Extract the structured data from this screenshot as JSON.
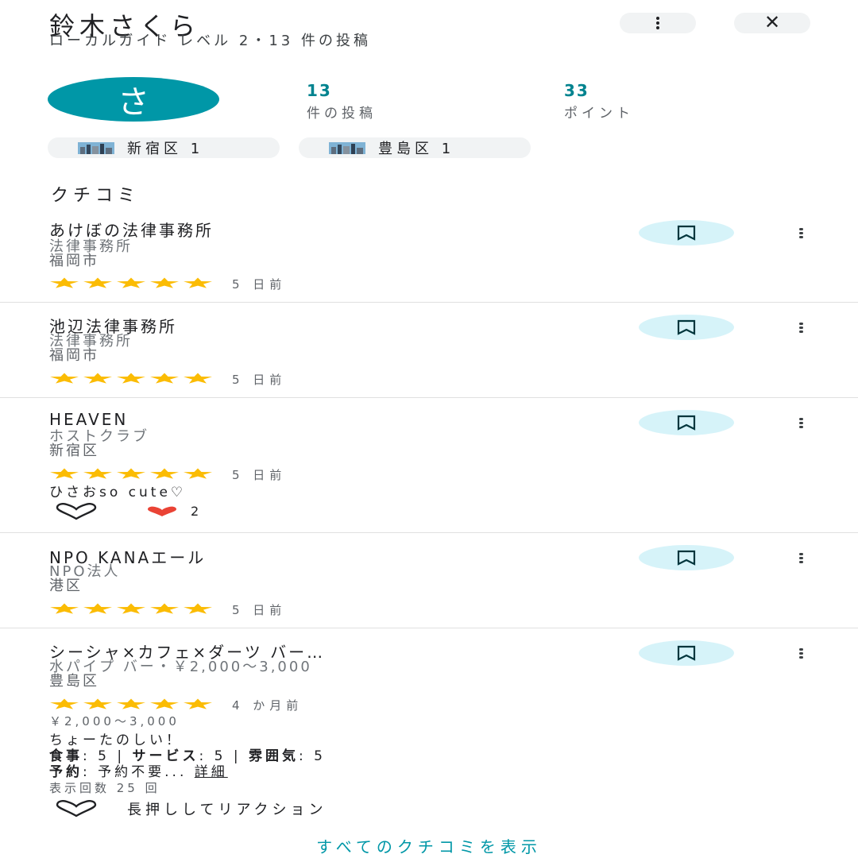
{
  "profile": {
    "name": "鈴木さくら",
    "subtitle": "ローカルガイド レベル 2・13 件の投稿",
    "avatar_letter": "さ",
    "avatar_color": "#0097a7",
    "posts_count": "13",
    "posts_label": "件の投稿",
    "points_count": "33",
    "points_label": "ポイント"
  },
  "area_chips": [
    {
      "label": "新宿区 1",
      "icon": "city-icon"
    },
    {
      "label": "豊島区 1",
      "icon": "city-icon"
    }
  ],
  "section_title": "クチコミ",
  "reviews": [
    {
      "name": "あけぼの法律事務所",
      "category": "法律事務所",
      "city": "福岡市",
      "rating": 5,
      "date": "5 日前"
    },
    {
      "name": "池辺法律事務所",
      "category": "法律事務所",
      "city": "福岡市",
      "rating": 5,
      "date": "5 日前"
    },
    {
      "name": "HEAVEN",
      "category": "ホストクラブ",
      "city": "新宿区",
      "rating": 5,
      "date": "5 日前",
      "text": "ひさおso cute♡",
      "reaction_count": "2"
    },
    {
      "name": "NPO KANAエール",
      "category": "NPO法人",
      "city": "港区",
      "rating": 5,
      "date": "5 日前"
    },
    {
      "name": "シーシャ×カフェ×ダーツ バー…",
      "category": "水パイプ バー・￥2,000〜3,000",
      "city": "豊島区",
      "rating": 5,
      "date": "4 か月前",
      "price": "￥2,000〜3,000",
      "text": "ちょーたのしい！",
      "food_label": "食事",
      "food_value": ": 5 | ",
      "service_label": "サービス",
      "service_value": ": 5 | ",
      "atmosphere_label": "雰囲気",
      "atmosphere_value": ": 5",
      "reservation_label": "予約",
      "reservation_value": ": 予約不要... ",
      "details_link": "詳細",
      "views": "表示回数 25 回",
      "longpress_hint": "長押ししてリアクション"
    }
  ],
  "show_all_label": "すべてのクチコミを表示",
  "colors": {
    "accent": "#0097a7",
    "star": "#fbbc04",
    "heart": "#ea4335",
    "save_bg": "#d6f3f9"
  }
}
